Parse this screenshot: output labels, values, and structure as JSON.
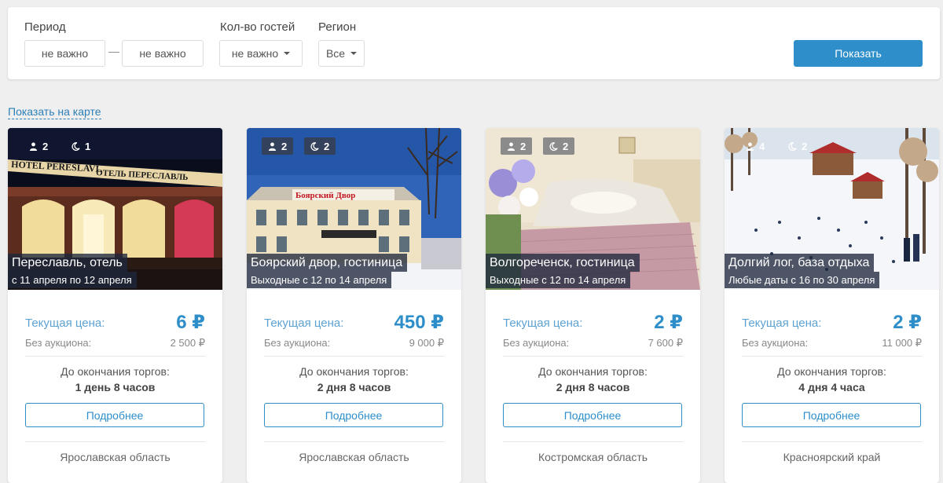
{
  "filters": {
    "period_label": "Период",
    "date_from": "не важно",
    "date_to": "не важно",
    "dash": "—",
    "guests_label": "Кол-во гостей",
    "guests_value": "не важно",
    "region_label": "Регион",
    "region_value": "Все",
    "show_button": "Показать"
  },
  "map_link": "Показать на карте",
  "colors": {
    "accent": "#2d8ec9",
    "link": "#2d7fb8",
    "overlay": "#1e283c"
  },
  "cards": [
    {
      "guests": "2",
      "nights": "1",
      "title": "Переславль, отель",
      "dates": "с 11 апреля по 12 апреля",
      "price_label": "Текущая цена:",
      "price": "6 ₽",
      "no_auction_label": "Без аукциона:",
      "no_auction_price": "2 500 ₽",
      "ends_label": "До окончания торгов:",
      "ends_value": "1 день 8 часов",
      "more": "Подробнее",
      "region": "Ярославская область",
      "sign_en": "HOTEL PERESLAVL",
      "sign_ru": "ОТЕЛЬ ПЕРЕСЛАВЛЬ"
    },
    {
      "guests": "2",
      "nights": "2",
      "title": "Боярский двор, гостиница",
      "dates": "Выходные с 12 по 14 апреля",
      "price_label": "Текущая цена:",
      "price": "450 ₽",
      "no_auction_label": "Без аукциона:",
      "no_auction_price": "9 000 ₽",
      "ends_label": "До окончания торгов:",
      "ends_value": "2 дня 8 часов",
      "more": "Подробнее",
      "region": "Ярославская область",
      "sign_ru": "Боярский Двор"
    },
    {
      "guests": "2",
      "nights": "2",
      "title": "Волгореченск, гостиница",
      "dates": "Выходные с 12 по 14 апреля",
      "price_label": "Текущая цена:",
      "price": "2 ₽",
      "no_auction_label": "Без аукциона:",
      "no_auction_price": "7 600 ₽",
      "ends_label": "До окончания торгов:",
      "ends_value": "2 дня 8 часов",
      "more": "Подробнее",
      "region": "Костромская область"
    },
    {
      "guests": "4",
      "nights": "2",
      "title": "Долгий лог, база отдыха",
      "dates": "Любые даты с 16 по 30 апреля",
      "price_label": "Текущая цена:",
      "price": "2 ₽",
      "no_auction_label": "Без аукциона:",
      "no_auction_price": "11 000 ₽",
      "ends_label": "До окончания торгов:",
      "ends_value": "4 дня 4 часа",
      "more": "Подробнее",
      "region": "Красноярский край"
    }
  ]
}
